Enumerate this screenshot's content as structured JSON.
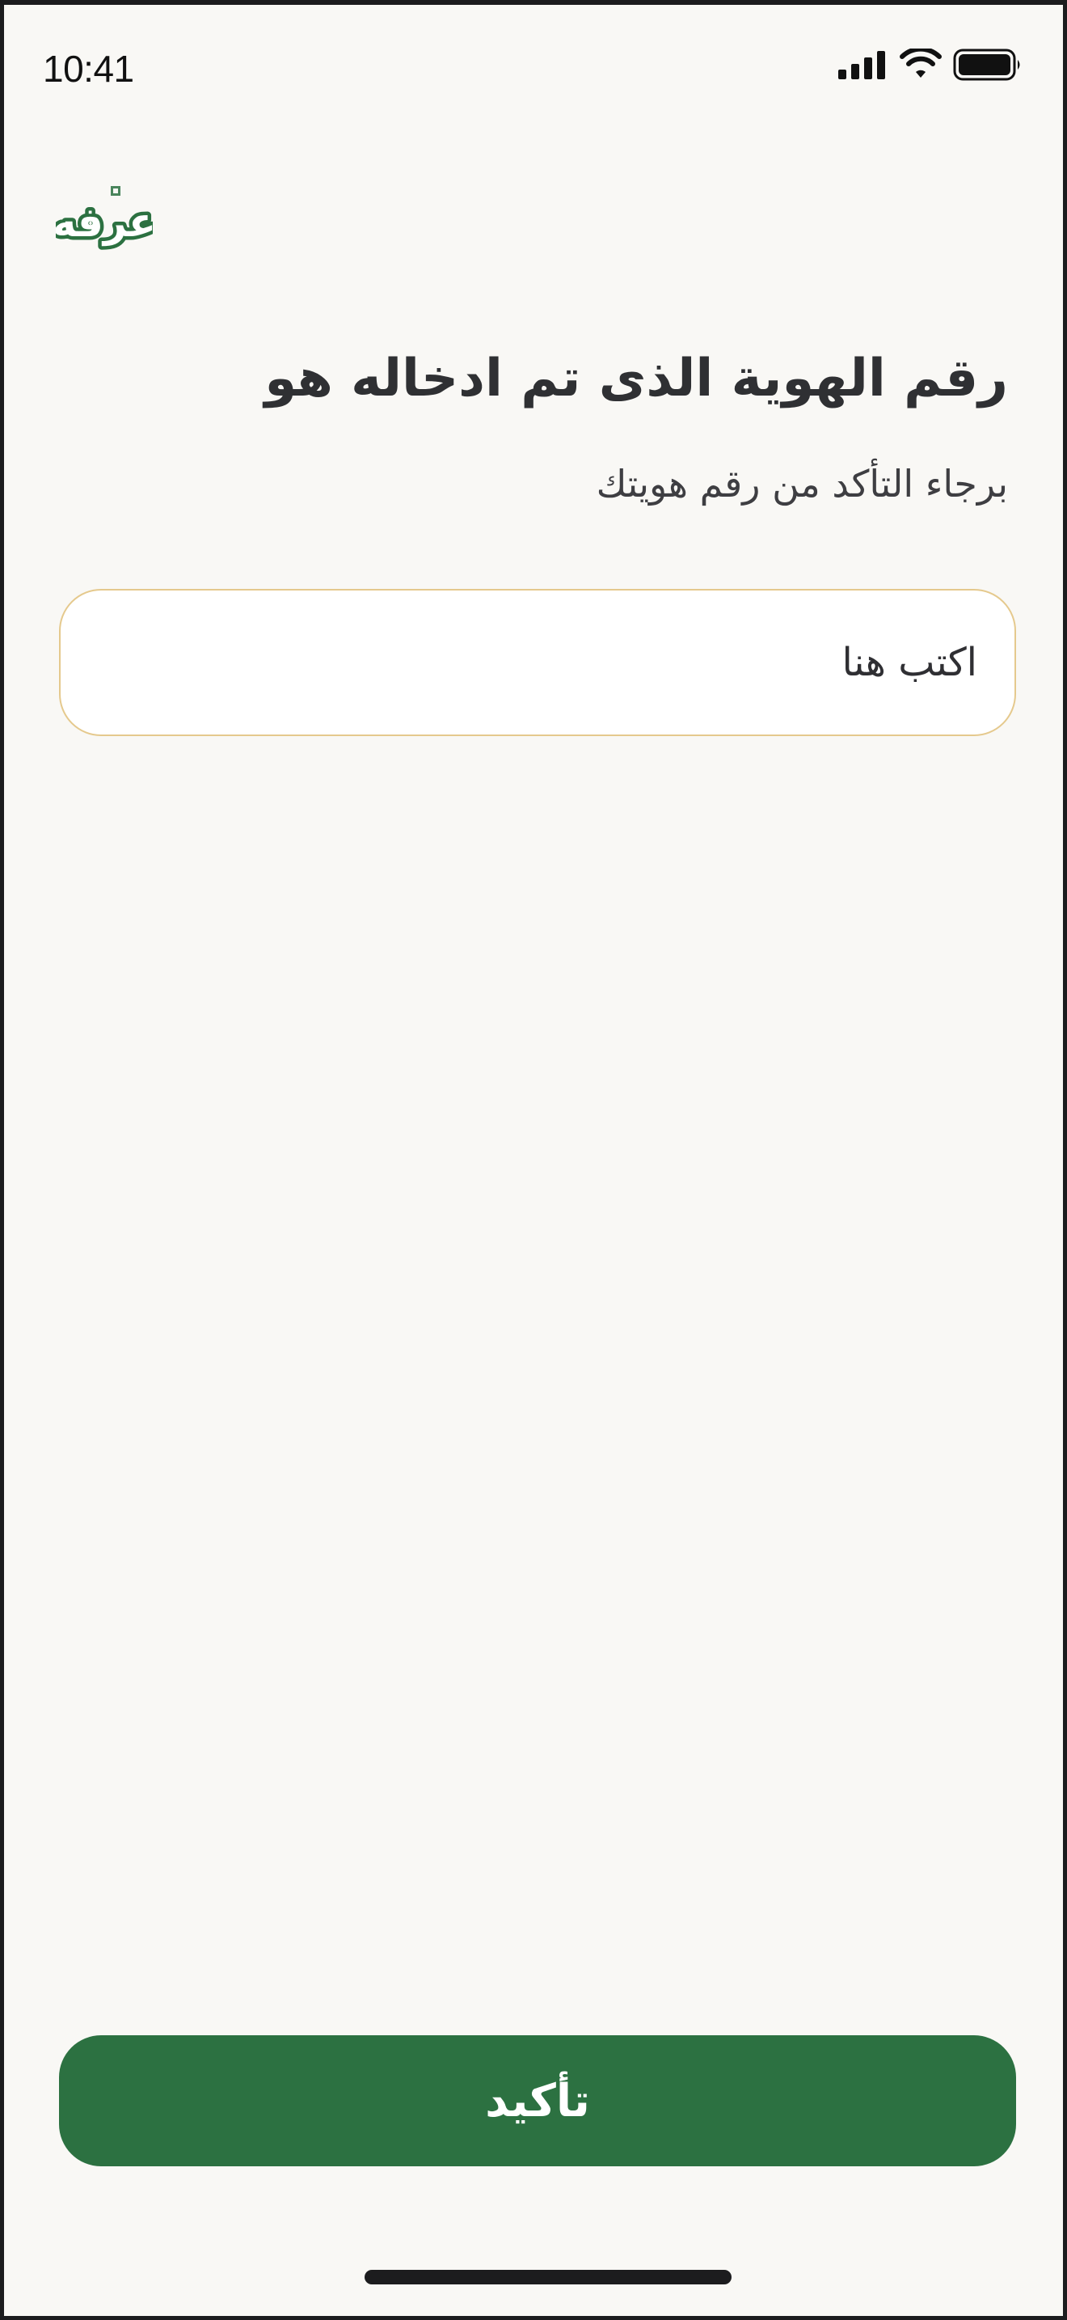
{
  "status_bar": {
    "time": "10:41",
    "signal_icon": "cellular-signal-icon",
    "wifi_icon": "wifi-icon",
    "battery_icon": "battery-icon"
  },
  "logo": {
    "text": "عرفه",
    "icon": "brand-logo-icon"
  },
  "page": {
    "title": "رقم الهوية الذى تم ادخاله هو",
    "subtitle": "برجاء التأكد من رقم هويتك"
  },
  "id_input": {
    "placeholder": "اكتب هنا",
    "value": ""
  },
  "confirm_button": {
    "label": "تأكيد"
  },
  "colors": {
    "background": "#f9f8f5",
    "primary": "#2c7141",
    "input_border": "#e5c98d",
    "text": "#2f3033"
  }
}
